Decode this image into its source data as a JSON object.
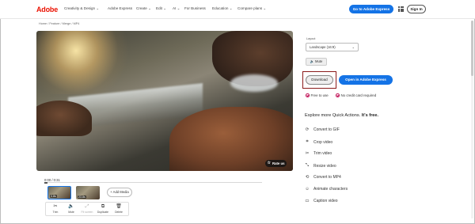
{
  "brand": {
    "logo": "Adobe",
    "accent": "#1473e6",
    "brand_red": "#eb1000"
  },
  "nav": {
    "items": [
      "Creativity & Design",
      "Adobe Express",
      "Create",
      "Edit",
      "AI",
      "For Business",
      "Education",
      "Compare plans"
    ],
    "go_express": "Go to Adobe Express",
    "sign_in": "Sign In"
  },
  "breadcrumb": [
    "Home",
    "/",
    "Feature",
    "/",
    "Merge",
    "/",
    "MP4"
  ],
  "video": {
    "rate_us": "Rate us"
  },
  "timeline": {
    "timecode": "0:00 / 0:31",
    "clips": [
      {
        "duration": "0.8s"
      },
      {
        "duration": "23.8s"
      }
    ],
    "add_media": "+ Add Media",
    "tools": [
      {
        "label": "Trim",
        "icon": "trim-icon",
        "glyph": "✂"
      },
      {
        "label": "Mute",
        "icon": "speaker-icon",
        "glyph": "🔈"
      },
      {
        "label": "Fit screen",
        "icon": "fit-screen-icon",
        "glyph": "⤢"
      },
      {
        "label": "Duplicate",
        "icon": "duplicate-icon",
        "glyph": "⧉"
      },
      {
        "label": "Delete",
        "icon": "trash-icon",
        "glyph": "🗑"
      }
    ]
  },
  "panel": {
    "layout_label": "Layout",
    "layout_value": "Landscape (16:9)",
    "mute": "Mute",
    "download": "Download",
    "open_express": "Open in Adobe Express",
    "features": [
      "Free to use",
      "No credit card required"
    ],
    "explore_prefix": "Explore more Quick Actions.",
    "explore_bold": "It's free.",
    "quick_actions": [
      {
        "label": "Convert to GIF",
        "icon": "gif-icon",
        "glyph": "⟳"
      },
      {
        "label": "Crop video",
        "icon": "crop-icon",
        "glyph": "⌗"
      },
      {
        "label": "Trim video",
        "icon": "trim-icon",
        "glyph": "✂"
      },
      {
        "label": "Resize video",
        "icon": "resize-icon",
        "glyph": "⤡"
      },
      {
        "label": "Convert to MP4",
        "icon": "convert-icon",
        "glyph": "⟲"
      },
      {
        "label": "Animate characters",
        "icon": "character-icon",
        "glyph": "☺"
      },
      {
        "label": "Caption video",
        "icon": "caption-icon",
        "glyph": "▭"
      }
    ]
  }
}
